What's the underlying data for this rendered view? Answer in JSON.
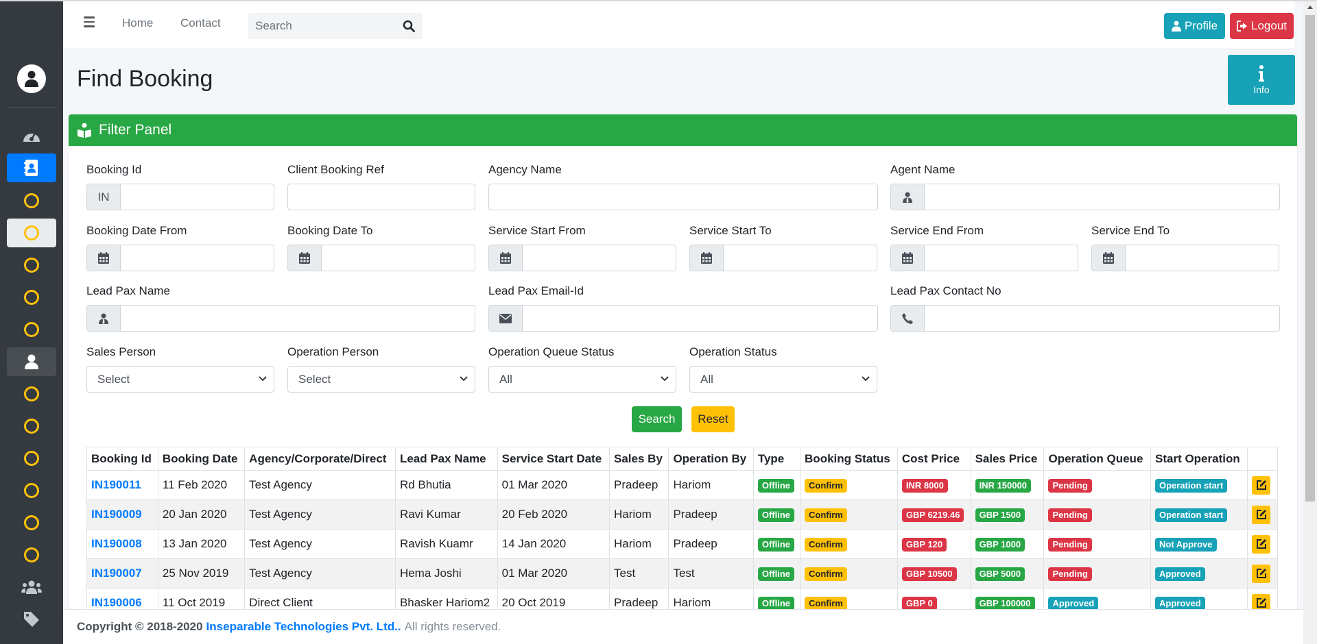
{
  "nav": {
    "home": "Home",
    "contact": "Contact",
    "search_placeholder": "Search",
    "profile": "Profile",
    "logout": "Logout"
  },
  "page": {
    "title": "Find Booking",
    "info": "Info"
  },
  "filter": {
    "title": "Filter Panel",
    "booking_id_label": "Booking Id",
    "booking_id_prefix": "IN",
    "client_ref_label": "Client Booking Ref",
    "agency_name_label": "Agency Name",
    "agent_name_label": "Agent Name",
    "booking_date_from_label": "Booking Date From",
    "booking_date_to_label": "Booking Date To",
    "service_start_from_label": "Service Start From",
    "service_start_to_label": "Service Start To",
    "service_end_from_label": "Service End From",
    "service_end_to_label": "Service End To",
    "lead_pax_name_label": "Lead Pax Name",
    "lead_pax_email_label": "Lead Pax Email-Id",
    "lead_pax_contact_label": "Lead Pax Contact No",
    "sales_person_label": "Sales Person",
    "sales_person_value": "Select",
    "operation_person_label": "Operation Person",
    "operation_person_value": "Select",
    "op_queue_status_label": "Operation Queue Status",
    "op_queue_status_value": "All",
    "op_status_label": "Operation Status",
    "op_status_value": "All",
    "search_btn": "Search",
    "reset_btn": "Reset"
  },
  "table": {
    "headers": [
      "Booking Id",
      "Booking Date",
      "Agency/Corporate/Direct",
      "Lead Pax Name",
      "Service Start Date",
      "Sales By",
      "Operation By",
      "Type",
      "Booking Status",
      "Cost Price",
      "Sales Price",
      "Operation Queue",
      "Start Operation",
      ""
    ],
    "rows": [
      {
        "id": "IN190011",
        "date": "11 Feb 2020",
        "agency": "Test Agency",
        "pax": "Rd Bhutia",
        "start": "01 Mar 2020",
        "sales": "Pradeep",
        "op": "Hariom",
        "type": "Offline",
        "status": "Confirm",
        "cost": "INR 8000",
        "price": "INR 150000",
        "queue": "Pending",
        "start_op": "Operation start"
      },
      {
        "id": "IN190009",
        "date": "20 Jan 2020",
        "agency": "Test Agency",
        "pax": "Ravi Kumar",
        "start": "20 Feb 2020",
        "sales": "Hariom",
        "op": "Pradeep",
        "type": "Offline",
        "status": "Confirm",
        "cost": "GBP 6219.46",
        "price": "GBP 1500",
        "queue": "Pending",
        "start_op": "Operation start"
      },
      {
        "id": "IN190008",
        "date": "13 Jan 2020",
        "agency": "Test Agency",
        "pax": "Ravish Kuamr",
        "start": "14 Jan 2020",
        "sales": "Hariom",
        "op": "Pradeep",
        "type": "Offline",
        "status": "Confirm",
        "cost": "GBP 120",
        "price": "GBP 1000",
        "queue": "Pending",
        "start_op": "Not Approve"
      },
      {
        "id": "IN190007",
        "date": "25 Nov 2019",
        "agency": "Test Agency",
        "pax": "Hema Joshi",
        "start": "01 Mar 2020",
        "sales": "Test",
        "op": "Test",
        "type": "Offline",
        "status": "Confirm",
        "cost": "GBP 10500",
        "price": "GBP 5000",
        "queue": "Pending",
        "start_op": "Approved"
      },
      {
        "id": "IN190006",
        "date": "11 Oct 2019",
        "agency": "Direct Client",
        "pax": "Bhasker Hariom2",
        "start": "20 Oct 2019",
        "sales": "Pradeep",
        "op": "Hariom",
        "type": "Offline",
        "status": "Confirm",
        "cost": "GBP 0",
        "price": "GBP 100000",
        "queue": "Approved",
        "start_op": "Approved"
      }
    ]
  },
  "footer": {
    "copyright": "Copyright © 2018-2020",
    "company": "Inseparable Technologies Pvt. Ltd..",
    "rights": "All rights reserved."
  },
  "colors": {
    "sidebar": "#343a40",
    "primary": "#007bff",
    "success": "#28a745",
    "warning": "#ffc107",
    "danger": "#dc3545",
    "info": "#17a2b8"
  },
  "icons": {
    "sidebar": [
      "user-avatar-icon",
      "dashboard-icon",
      "contact-book-icon",
      "circle-icon",
      "users-icon",
      "tag-icon"
    ],
    "fields": [
      "calendar-icon",
      "user-tie-icon",
      "envelope-icon",
      "phone-icon",
      "chevron-down-icon",
      "edit-icon"
    ]
  }
}
